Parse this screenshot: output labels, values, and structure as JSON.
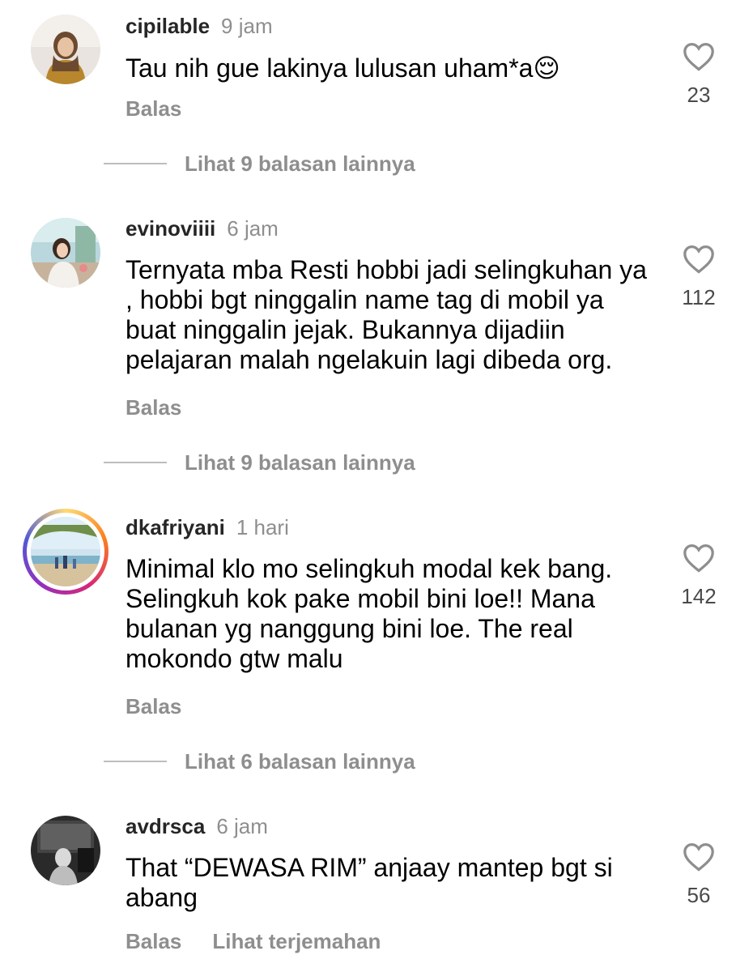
{
  "comments": [
    {
      "username": "cipilable",
      "time": "9 jam",
      "text": "Tau nih gue lakinya lulusan uham*a😌",
      "likes": "23",
      "reply_label": "Balas",
      "view_replies": "Lihat 9 balasan lainnya"
    },
    {
      "username": "evinoviiii",
      "time": "6 jam",
      "text": "Ternyata mba Resti hobbi jadi selingkuhan ya , hobbi bgt ninggalin name tag di mobil ya buat ninggalin jejak. Bukannya dijadiin pelajaran malah ngelakuin lagi dibeda org.",
      "likes": "112",
      "reply_label": "Balas",
      "view_replies": "Lihat 9 balasan lainnya"
    },
    {
      "username": "dkafriyani",
      "time": "1 hari",
      "text": "Minimal klo mo selingkuh modal kek bang. Selingkuh kok pake mobil bini loe!! Mana bulanan yg nanggung bini loe. The real mokondo gtw malu",
      "likes": "142",
      "reply_label": "Balas",
      "view_replies": "Lihat 6 balasan lainnya"
    },
    {
      "username": "avdrsca",
      "time": "6 jam",
      "text": "That “DEWASA RIM” anjaay mantep bgt si abang",
      "likes": "56",
      "reply_label": "Balas",
      "translate_label": "Lihat terjemahan"
    }
  ],
  "icons": {
    "like": "heart-outline-icon"
  },
  "colors": {
    "username": "#262626",
    "secondary": "#8e8e8e",
    "divider": "#bdbdbd"
  }
}
